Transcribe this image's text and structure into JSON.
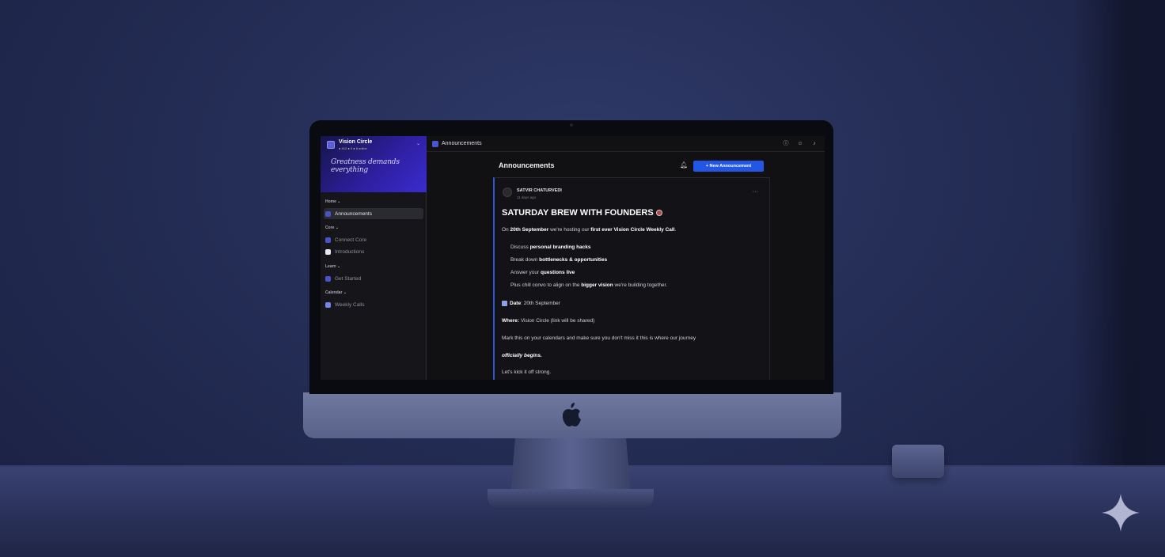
{
  "workspace": {
    "name": "Vision Circle",
    "meta": "● 412 ● 0 ● 8 online",
    "tagline": "Greatness demands everything"
  },
  "sidebar": {
    "sections": [
      {
        "label": "Home ⌄",
        "items": [
          {
            "label": "Announcements",
            "active": true
          }
        ]
      },
      {
        "label": "Core ⌄",
        "items": [
          {
            "label": "Connect Core",
            "active": false
          },
          {
            "label": "Introductions",
            "active": false
          }
        ]
      },
      {
        "label": "Learn ⌄",
        "items": [
          {
            "label": "Get Started",
            "active": false
          }
        ]
      },
      {
        "label": "Calendar ⌄",
        "items": [
          {
            "label": "Weekly Calls",
            "active": false
          }
        ]
      }
    ]
  },
  "topbar": {
    "title": "Announcements",
    "actions": [
      "info-icon",
      "members-icon",
      "notifications-icon"
    ]
  },
  "panel": {
    "title": "Announcements",
    "new_button_label": "+   New Announcement"
  },
  "post": {
    "author": "SATVIR CHATURVEDI",
    "time": "11 days ago",
    "title": "SATURDAY BREW WITH FOUNDERS",
    "intro_prefix": "On ",
    "intro_date": "20th September",
    "intro_mid": " we're hosting our ",
    "intro_bold": "first ever Vision Circle Weekly Call",
    "intro_suffix": ".",
    "bullets": [
      {
        "prefix": "Discuss ",
        "bold": "personal branding hacks",
        "suffix": ""
      },
      {
        "prefix": "Break down ",
        "bold": "bottlenecks & opportunities",
        "suffix": ""
      },
      {
        "prefix": "Answer your ",
        "bold": "questions live",
        "suffix": ""
      },
      {
        "prefix": "Plus chill convo to align on the ",
        "bold": "bigger vision",
        "suffix": " we're building together."
      }
    ],
    "date_label": "Date",
    "date_value": ": 20th September",
    "where_label": "Where:",
    "where_value": " Vision Circle (link will be shared)",
    "reminder": "Mark this on your calendars and make sure you don't miss it this is where our journey",
    "reminder_bold": "officially begins.",
    "closing": "Let's kick it off strong."
  },
  "colors": {
    "accent": "#2456e6",
    "banner": "#2d1f9e",
    "background": "#242d55"
  }
}
